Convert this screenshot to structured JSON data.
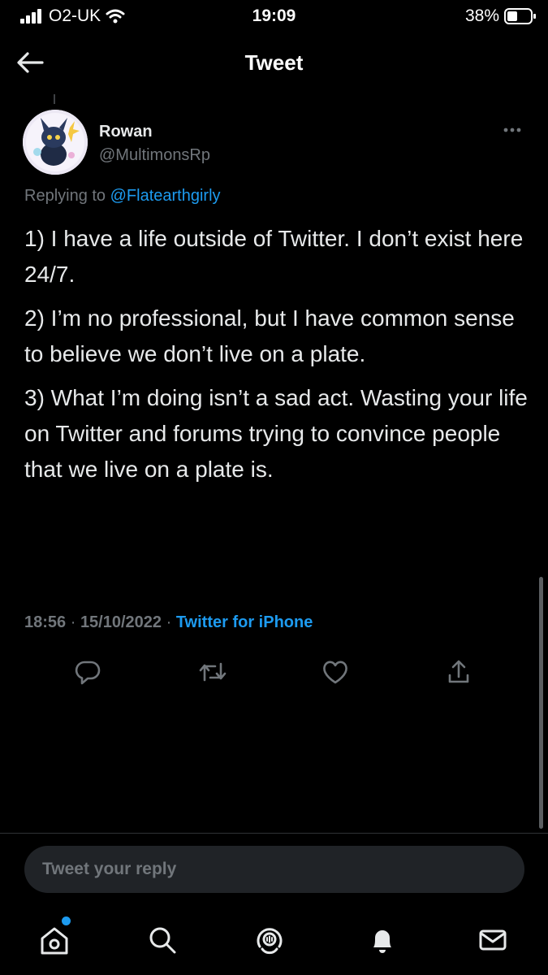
{
  "status_bar": {
    "carrier": "O2-UK",
    "time": "19:09",
    "battery": "38%"
  },
  "header": {
    "title": "Tweet"
  },
  "tweet": {
    "author_name": "Rowan",
    "author_handle": "@MultimonsRp",
    "replying_prefix": "Replying to",
    "replying_to": "@Flatearthgirly",
    "paragraphs": [
      "1) I have a life outside of Twitter. I don’t exist here 24/7.",
      "2) I’m no professional, but I have common sense to believe we don’t live on a plate.",
      "3) What I’m doing isn’t a sad act. Wasting your life on Twitter and forums trying to convince people that we live on a plate is."
    ],
    "time": "18:56",
    "date": "15/10/2022",
    "source": "Twitter for iPhone"
  },
  "reply": {
    "placeholder": "Tweet your reply"
  },
  "colors": {
    "accent": "#1d9bf0",
    "background": "#000000",
    "secondary_text": "#71767b"
  },
  "icons": {
    "back": "arrow-left-icon",
    "more": "more-dots-icon",
    "reply": "reply-icon",
    "retweet": "retweet-icon",
    "like": "heart-icon",
    "share": "share-icon",
    "home": "home-icon",
    "search": "search-icon",
    "spaces": "spaces-icon",
    "notifications": "bell-icon",
    "messages": "mail-icon"
  }
}
